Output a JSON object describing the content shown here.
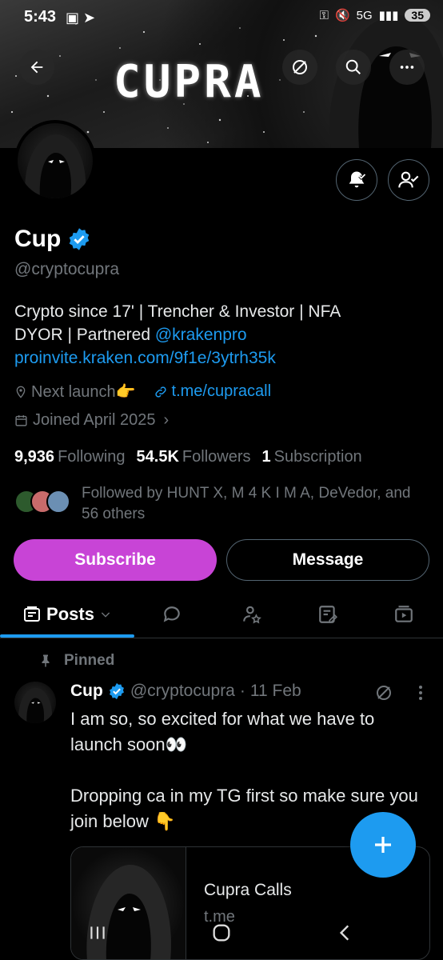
{
  "status_bar": {
    "time": "5:43",
    "network": "5G",
    "battery": "35"
  },
  "banner": {
    "title": "CUPRA"
  },
  "profile": {
    "name": "Cup",
    "handle": "@cryptocupra",
    "bio_line1": "Crypto since 17' | Trencher & Investor | NFA",
    "bio_line2_prefix": "DYOR | Partnered ",
    "bio_mention": "@krakenpro",
    "bio_link": "proinvite.kraken.com/9f1e/3ytrh35k",
    "location": "Next launch👉",
    "website": "t.me/cupracall",
    "joined": "Joined April 2025",
    "following_count": "9,936",
    "following_label": "Following",
    "followers_count": "54.5K",
    "followers_label": "Followers",
    "subscription_count": "1",
    "subscription_label": "Subscription",
    "followed_by": "Followed by HUNT X, M 4 K I M A, DeVedor, and 56 others"
  },
  "actions": {
    "subscribe": "Subscribe",
    "message": "Message"
  },
  "tabs": {
    "posts": "Posts"
  },
  "post": {
    "pinned_label": "Pinned",
    "author": "Cup",
    "handle": "@cryptocupra",
    "separator": "·",
    "date": "11 Feb",
    "text": "I am so, so excited for what we have to launch soon👀\n\nDropping ca in my TG first so make sure you join below 👇",
    "card_title": "Cupra Calls",
    "card_domain": "t.me"
  },
  "colors": {
    "accent": "#1d9bf0",
    "subscribe": "#c844d6",
    "background": "#000000"
  }
}
